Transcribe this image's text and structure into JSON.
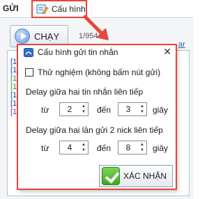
{
  "tabs": {
    "gui_label": "GỬI",
    "config_label": "Cấu hình"
  },
  "main": {
    "run_button_label": "CHẠY",
    "counter_text": "1/954",
    "link_fragment": "ar",
    "log_markers": [
      "[1",
      "[1",
      "[1",
      "[1",
      "[1",
      "[1",
      "[1"
    ]
  },
  "dialog": {
    "title": "Cấu hình gửi tin nhắn",
    "close_glyph": "✕",
    "test_checkbox_label": "Thử nghiệm (không bấm nút gửi)",
    "test_checked": false,
    "delay_messages": {
      "label": "Delay giữa hai tin nhắn liên tiếp",
      "from_label": "từ",
      "from_value": "2",
      "to_label": "đến",
      "to_value": "3",
      "unit": "giây"
    },
    "delay_nicks": {
      "label": "Delay giữa hai lần gửi 2 nick liên tiếp",
      "from_label": "từ",
      "from_value": "4",
      "to_label": "đến",
      "to_value": "8",
      "unit": "giây"
    },
    "confirm_label": "XÁC NHẬN"
  },
  "colors": {
    "highlight": "#e8453c",
    "confirm_green": "#3fa61f",
    "play_blue": "#6f9bd8"
  }
}
